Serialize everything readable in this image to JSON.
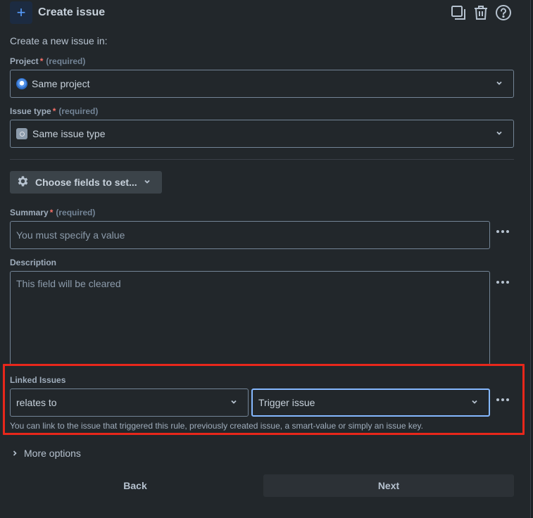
{
  "header": {
    "title": "Create issue",
    "icons": [
      "plus-icon",
      "copy-icon",
      "trash-icon",
      "help-icon"
    ]
  },
  "intro": "Create a new issue in:",
  "project": {
    "label": "Project",
    "required_mark": "*",
    "required_hint": "(required)",
    "value": "Same project"
  },
  "issue_type": {
    "label": "Issue type",
    "required_mark": "*",
    "required_hint": "(required)",
    "value": "Same issue type"
  },
  "choose_fields": {
    "label": "Choose fields to set..."
  },
  "summary": {
    "label": "Summary",
    "required_mark": "*",
    "required_hint": "(required)",
    "placeholder": "You must specify a value"
  },
  "description": {
    "label": "Description",
    "placeholder": "This field will be cleared"
  },
  "linked_issues": {
    "label": "Linked Issues",
    "link_type": "relates to",
    "target": "Trigger issue",
    "help": "You can link to the issue that triggered this rule, previously created issue, a smart-value or simply an issue key."
  },
  "more_options": {
    "label": "More options"
  },
  "footer": {
    "back_label": "Back",
    "next_label": "Next"
  },
  "colors": {
    "highlight": "#e8271b",
    "focus_border": "#85b8ff",
    "required": "#f87168"
  }
}
